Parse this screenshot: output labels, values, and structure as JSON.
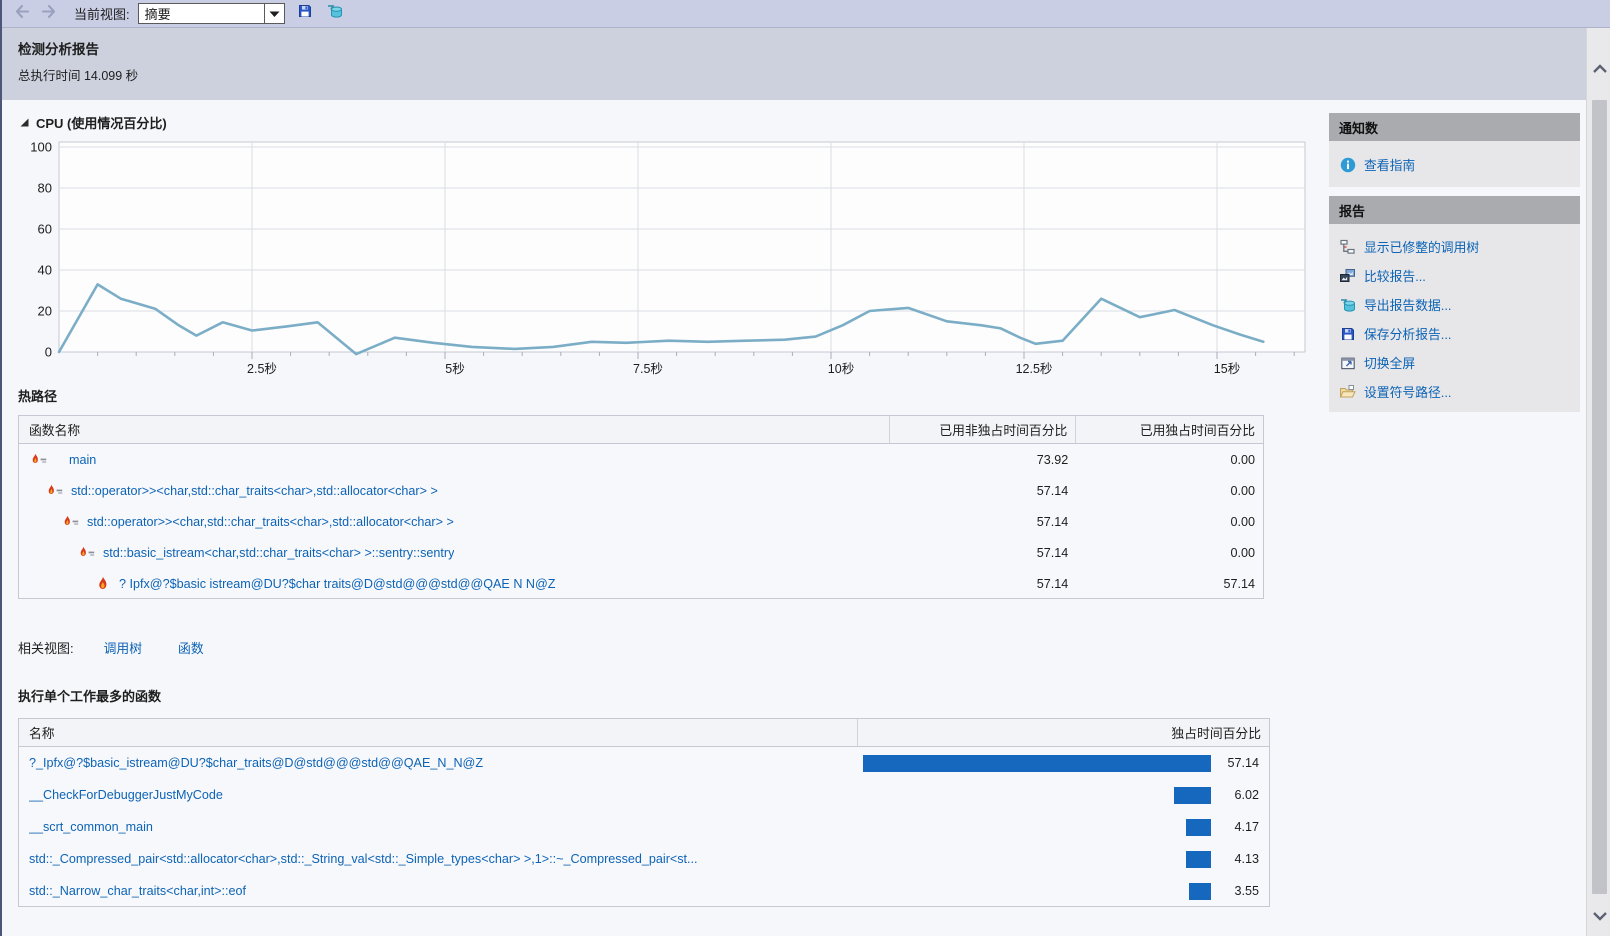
{
  "toolbar": {
    "current_view_label": "当前视图:",
    "view_value": "摘要"
  },
  "header": {
    "title": "检测分析报告",
    "subtitle": "总执行时间 14.099 秒"
  },
  "cpu_section": {
    "title": "CPU (使用情况百分比)"
  },
  "chart_data": {
    "type": "line",
    "title": "CPU (使用情况百分比)",
    "xlabel": "",
    "ylabel": "",
    "ylim": [
      0,
      100
    ],
    "xlim": [
      0,
      16.1
    ],
    "grid": true,
    "y_ticks": [
      "100",
      "80",
      "60",
      "40",
      "20",
      "0"
    ],
    "y_tick_values": [
      100,
      80,
      60,
      40,
      20,
      0
    ],
    "x_ticks": [
      "2.5秒",
      "5秒",
      "7.5秒",
      "10秒",
      "12.5秒",
      "15秒"
    ],
    "x_tick_values": [
      2.5,
      5,
      7.5,
      10,
      12.5,
      15
    ],
    "minor_tick_step": 0.5,
    "line_color": "#7BAEC6",
    "series": [
      {
        "name": "CPU 使用情况百分比",
        "points": [
          [
            0,
            0
          ],
          [
            0.5,
            33
          ],
          [
            0.8,
            26
          ],
          [
            1.25,
            21
          ],
          [
            1.55,
            13
          ],
          [
            1.78,
            8
          ],
          [
            2.12,
            14.5
          ],
          [
            2.5,
            10.5
          ],
          [
            2.95,
            12.5
          ],
          [
            3.35,
            14.5
          ],
          [
            3.85,
            -1
          ],
          [
            4.35,
            7
          ],
          [
            4.85,
            4.5
          ],
          [
            5.35,
            2.5
          ],
          [
            5.9,
            1.5
          ],
          [
            6.4,
            2.5
          ],
          [
            6.9,
            5
          ],
          [
            7.35,
            4.5
          ],
          [
            7.9,
            5.5
          ],
          [
            8.4,
            5
          ],
          [
            8.9,
            5.5
          ],
          [
            9.4,
            6
          ],
          [
            9.8,
            7.5
          ],
          [
            10.15,
            13
          ],
          [
            10.5,
            20
          ],
          [
            11.0,
            21.5
          ],
          [
            11.5,
            15
          ],
          [
            11.95,
            13
          ],
          [
            12.2,
            11.5
          ],
          [
            12.45,
            7
          ],
          [
            12.65,
            4
          ],
          [
            13.0,
            5.5
          ],
          [
            13.5,
            26
          ],
          [
            14.0,
            17
          ],
          [
            14.45,
            20.5
          ],
          [
            14.95,
            13
          ],
          [
            15.3,
            8.5
          ],
          [
            15.6,
            5
          ]
        ]
      }
    ]
  },
  "sidebar": {
    "notifications": {
      "title": "通知数",
      "link_label": "查看指南",
      "link_icon": "info-icon"
    },
    "reports": {
      "title": "报告",
      "items": [
        {
          "label": "显示已修整的调用树",
          "icon": "calltree-icon"
        },
        {
          "label": "比较报告...",
          "icon": "compare-reports-icon"
        },
        {
          "label": "导出报告数据...",
          "icon": "export-data-icon"
        },
        {
          "label": "保存分析报告...",
          "icon": "save-report-icon"
        },
        {
          "label": "切换全屏",
          "icon": "fullscreen-icon"
        },
        {
          "label": "设置符号路径...",
          "icon": "symbol-path-icon"
        }
      ]
    }
  },
  "hot_path": {
    "title": "热路径",
    "columns": [
      "函数名称",
      "已用非独占时间百分比",
      "已用独占时间百分比"
    ],
    "rows": [
      {
        "name": "main",
        "inclusive": "73.92",
        "exclusive": "0.00",
        "level": 0,
        "icon": "hot-path-icon"
      },
      {
        "name": "std::operator>><char,std::char_traits<char>,std::allocator<char> >",
        "inclusive": "57.14",
        "exclusive": "0.00",
        "level": 1,
        "icon": "hot-path-icon"
      },
      {
        "name": "std::operator>><char,std::char_traits<char>,std::allocator<char> >",
        "inclusive": "57.14",
        "exclusive": "0.00",
        "level": 2,
        "icon": "hot-path-icon"
      },
      {
        "name": "std::basic_istream<char,std::char_traits<char> >::sentry::sentry",
        "inclusive": "57.14",
        "exclusive": "0.00",
        "level": 3,
        "icon": "hot-path-icon"
      },
      {
        "name": "? Ipfx@?$basic istream@DU?$char traits@D@std@@@std@@QAE N N@Z",
        "inclusive": "57.14",
        "exclusive": "57.14",
        "level": 4,
        "icon": "flame-icon"
      }
    ]
  },
  "related_views": {
    "label": "相关视图:",
    "links": [
      "调用树",
      "函数"
    ]
  },
  "most_work": {
    "title": "执行单个工作最多的函数",
    "columns": [
      "名称",
      "独占时间百分比"
    ],
    "bar_color": "#1668BE",
    "bar_full_scale_percent": 100,
    "rows": [
      {
        "name": "?_Ipfx@?$basic_istream@DU?$char_traits@D@std@@@std@@QAE_N_N@Z",
        "value": "57.14"
      },
      {
        "name": "__CheckForDebuggerJustMyCode",
        "value": "6.02"
      },
      {
        "name": "__scrt_common_main",
        "value": "4.17"
      },
      {
        "name": "std::_Compressed_pair<std::allocator<char>,std::_String_val<std::_Simple_types<char> >,1>::~_Compressed_pair<st...",
        "value": "4.13"
      },
      {
        "name": "std::_Narrow_char_traits<char,int>::eof",
        "value": "3.55"
      }
    ]
  },
  "colors": {
    "accent_link": "#0D63B5",
    "chart_line": "#7BAEC6",
    "bar": "#1668BE",
    "toolbar_bg": "#C9CEE4",
    "header_bg": "#CDD1DE",
    "section_header_bg": "#A9ABAF"
  }
}
